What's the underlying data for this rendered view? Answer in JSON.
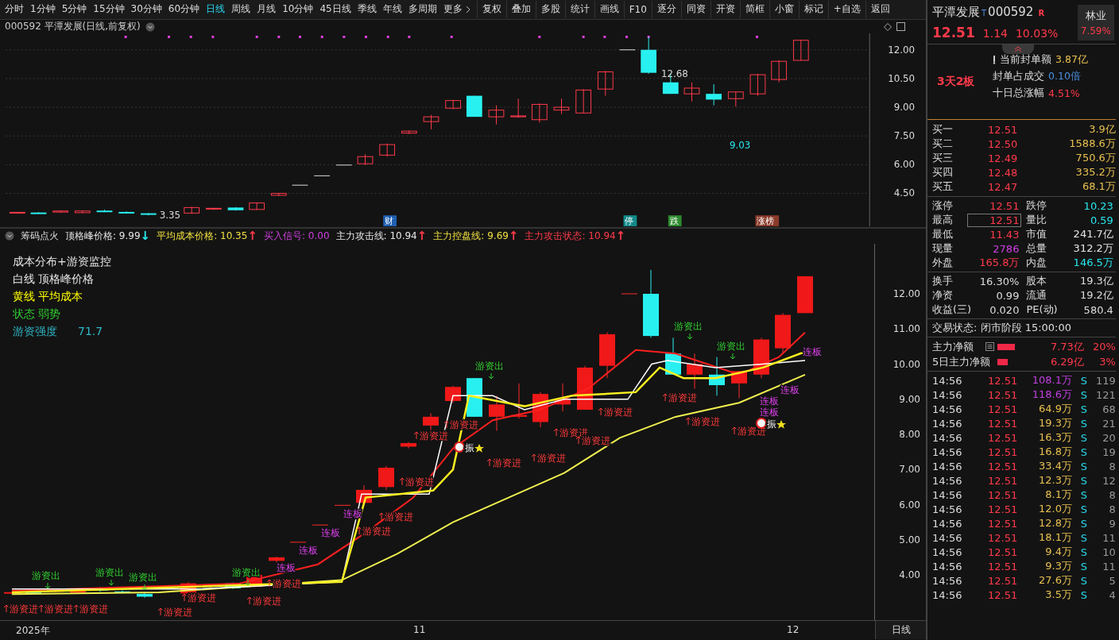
{
  "toolbar": {
    "periods": [
      {
        "label": "分时",
        "selected": false
      },
      {
        "label": "1分钟",
        "selected": false
      },
      {
        "label": "5分钟",
        "selected": false
      },
      {
        "label": "15分钟",
        "selected": false
      },
      {
        "label": "30分钟",
        "selected": false
      },
      {
        "label": "60分钟",
        "selected": false
      },
      {
        "label": "日线",
        "selected": true
      },
      {
        "label": "周线",
        "selected": false
      },
      {
        "label": "月线",
        "selected": false
      },
      {
        "label": "10分钟",
        "selected": false
      },
      {
        "label": "45日线",
        "selected": false
      },
      {
        "label": "季线",
        "selected": false
      },
      {
        "label": "年线",
        "selected": false
      },
      {
        "label": "多周期",
        "selected": false
      }
    ],
    "more": "更多",
    "tools": [
      "复权",
      "叠加",
      "多股",
      "统计",
      "画线",
      "F10",
      "逐分",
      "同资",
      "开资",
      "简框",
      "小窗",
      "标记",
      "+自选",
      "返回"
    ]
  },
  "price_chart": {
    "title": "000592 平潭发展(日线,前复权)",
    "axis": [
      "12.00",
      "10.50",
      "9.00",
      "7.50",
      "6.00",
      "4.50"
    ],
    "price_marks": [
      {
        "text": "12.68",
        "kind": "high"
      },
      {
        "text": "3.35",
        "kind": "low"
      },
      {
        "text": "9.03",
        "kind": "local"
      }
    ],
    "event_tags": [
      {
        "text": "财",
        "color": "#1f5fb0"
      },
      {
        "text": "停",
        "color": "#138a8a"
      },
      {
        "text": "跌",
        "color": "#2e8b2e"
      },
      {
        "text": "涨榜",
        "color": "#8a3a2a"
      }
    ]
  },
  "indicator": {
    "name": "筹码点火",
    "readouts": [
      {
        "label": "顶格峰价格:",
        "value": "9.99",
        "arrow": {
          "text": "↓",
          "color": "#28e8f0"
        },
        "color": "#e6e6e6"
      },
      {
        "label": "平均成本价格:",
        "value": "10.35",
        "arrow": {
          "text": "↑",
          "color": "#ff3a4a"
        },
        "color": "#f0e040"
      },
      {
        "label": "买入信号:",
        "value": "0.00",
        "color": "#d040e0"
      },
      {
        "label": "主力攻击线:",
        "value": "10.94",
        "arrow": {
          "text": "↑",
          "color": "#ff3a4a"
        },
        "color": "#e6e6e6"
      },
      {
        "label": "主力控盘线:",
        "value": "9.69",
        "arrow": {
          "text": "↑",
          "color": "#ff3a4a"
        },
        "color": "#f0e040"
      },
      {
        "label": "主力攻击状态:",
        "value": "10.94",
        "arrow": {
          "text": "↑",
          "color": "#ff3a4a"
        },
        "color": "#ff3a4a"
      }
    ],
    "legend": [
      {
        "text": "成本分布+游资监控",
        "color": "#e6e6e6"
      },
      {
        "text": "白线 顶格峰价格",
        "color": "#e6e6e6"
      },
      {
        "text": "黄线 平均成本",
        "color": "#ffff00"
      },
      {
        "text": "状态 弱势",
        "color": "#30d030"
      },
      {
        "text": "游资强度",
        "value": "71.7",
        "color": "#30b8c8"
      }
    ],
    "axis": [
      "12.00",
      "11.00",
      "10.00",
      "9.00",
      "8.00",
      "7.00",
      "6.00",
      "5.00",
      "4.00"
    ],
    "signals": [
      {
        "kind": "out",
        "text": "游资出"
      },
      {
        "kind": "out",
        "text": "游资出"
      },
      {
        "kind": "out",
        "text": "游资出"
      },
      {
        "kind": "out",
        "text": "游资出"
      },
      {
        "kind": "out",
        "text": "游资出"
      },
      {
        "kind": "out",
        "text": "游资出"
      },
      {
        "kind": "out",
        "text": "游资出"
      },
      {
        "kind": "in",
        "text": "游资进"
      },
      {
        "kind": "in",
        "text": "游资进"
      },
      {
        "kind": "in",
        "text": "游资进"
      },
      {
        "kind": "in",
        "text": "游资进"
      },
      {
        "kind": "in",
        "text": "游资进"
      },
      {
        "kind": "in",
        "text": "游资进"
      },
      {
        "kind": "in",
        "text": "游资进"
      },
      {
        "kind": "in",
        "text": "游资进"
      },
      {
        "kind": "in",
        "text": "游资进"
      },
      {
        "kind": "in",
        "text": "游资进"
      },
      {
        "kind": "in",
        "text": "游资进"
      },
      {
        "kind": "in",
        "text": "游资进"
      },
      {
        "kind": "in",
        "text": "游资进"
      },
      {
        "kind": "in",
        "text": "游资进"
      },
      {
        "kind": "in",
        "text": "游资进"
      },
      {
        "kind": "in",
        "text": "游资进"
      },
      {
        "kind": "in",
        "text": "游资进"
      },
      {
        "kind": "in",
        "text": "游资进"
      },
      {
        "kind": "in",
        "text": "游资进"
      },
      {
        "kind": "in",
        "text": "游资进"
      },
      {
        "kind": "board",
        "text": "连板"
      },
      {
        "kind": "board",
        "text": "连板"
      },
      {
        "kind": "board",
        "text": "连板"
      },
      {
        "kind": "board",
        "text": "连板"
      },
      {
        "kind": "board",
        "text": "连板"
      },
      {
        "kind": "board",
        "text": "连板"
      },
      {
        "kind": "board",
        "text": "连板"
      },
      {
        "kind": "board",
        "text": "连板"
      },
      {
        "kind": "start",
        "text": "振"
      },
      {
        "kind": "start",
        "text": "振"
      }
    ]
  },
  "time_axis": {
    "labels": [
      "2025年",
      "11",
      "12"
    ],
    "period_button": "日线"
  },
  "quote": {
    "name": "平潭发展",
    "t_mark": "T",
    "code": "000592",
    "r_mark": "R",
    "industry": "林业",
    "industry_change": "7.59%",
    "price": "12.51",
    "change": "1.14",
    "change_pct": "10.03%",
    "streak": "3天2板",
    "seal": [
      {
        "label": "当前封单额",
        "value": "3.87亿",
        "color": "#e8c050"
      },
      {
        "label": "封单占成交",
        "value": "0.10倍",
        "color": "#4a90e0"
      },
      {
        "label": "十日总涨幅",
        "value": "4.51%",
        "color": "#ff3a4a"
      }
    ],
    "book": [
      {
        "label": "买一",
        "price": "12.51",
        "volume": "3.9亿"
      },
      {
        "label": "买二",
        "price": "12.50",
        "volume": "1588.6万"
      },
      {
        "label": "买三",
        "price": "12.49",
        "volume": "750.6万"
      },
      {
        "label": "买四",
        "price": "12.48",
        "volume": "335.2万"
      },
      {
        "label": "买五",
        "price": "12.47",
        "volume": "68.1万"
      }
    ],
    "stats": [
      {
        "label": "涨停",
        "value": "12.51",
        "color": "#ff3a4a",
        "boxed": false
      },
      {
        "label": "跌停",
        "value": "10.23",
        "color": "#28e8f0",
        "boxed": false
      },
      {
        "label": "最高",
        "value": "12.51",
        "color": "#ff3a4a",
        "boxed": true
      },
      {
        "label": "量比",
        "value": "0.59",
        "color": "#28e8f0",
        "boxed": false
      },
      {
        "label": "最低",
        "value": "11.43",
        "color": "#ff3a4a",
        "boxed": false
      },
      {
        "label": "市值",
        "value": "241.7亿",
        "color": "#e6e6e6",
        "boxed": false
      },
      {
        "label": "现量",
        "value": "2786",
        "color": "#d040e0",
        "boxed": false
      },
      {
        "label": "总量",
        "value": "312.2万",
        "color": "#e6e6e6",
        "boxed": false
      },
      {
        "label": "外盘",
        "value": "165.8万",
        "color": "#ff3a4a",
        "boxed": false
      },
      {
        "label": "内盘",
        "value": "146.5万",
        "color": "#28e8f0",
        "boxed": false
      }
    ],
    "stats2": [
      {
        "label": "换手",
        "value": "16.30%"
      },
      {
        "label": "股本",
        "value": "19.3亿"
      },
      {
        "label": "净资",
        "value": "0.99"
      },
      {
        "label": "流通",
        "value": "19.2亿"
      },
      {
        "label": "收益(三)",
        "value": "0.020"
      },
      {
        "label": "PE(动)",
        "value": "580.4"
      }
    ],
    "status": "交易状态: 闭市阶段 15:00:00",
    "flows": [
      {
        "label": "主力净额",
        "value": "7.73亿",
        "pct": "20%"
      },
      {
        "label": "5日主力净额",
        "value": "6.29亿",
        "pct": "3%"
      }
    ],
    "trades": [
      {
        "time": "14:56",
        "price": "12.51",
        "volume": "108.1万",
        "kind": "big",
        "side": "S",
        "count": "119"
      },
      {
        "time": "14:56",
        "price": "12.51",
        "volume": "118.6万",
        "kind": "big",
        "side": "S",
        "count": "121"
      },
      {
        "time": "14:56",
        "price": "12.51",
        "volume": "64.9万",
        "kind": "normal",
        "side": "S",
        "count": "68"
      },
      {
        "time": "14:56",
        "price": "12.51",
        "volume": "19.3万",
        "kind": "normal",
        "side": "S",
        "count": "21"
      },
      {
        "time": "14:56",
        "price": "12.51",
        "volume": "16.3万",
        "kind": "normal",
        "side": "S",
        "count": "20"
      },
      {
        "time": "14:56",
        "price": "12.51",
        "volume": "16.8万",
        "kind": "normal",
        "side": "S",
        "count": "19"
      },
      {
        "time": "14:56",
        "price": "12.51",
        "volume": "33.4万",
        "kind": "normal",
        "side": "S",
        "count": "8"
      },
      {
        "time": "14:56",
        "price": "12.51",
        "volume": "12.3万",
        "kind": "normal",
        "side": "S",
        "count": "12"
      },
      {
        "time": "14:56",
        "price": "12.51",
        "volume": "8.1万",
        "kind": "normal",
        "side": "S",
        "count": "8"
      },
      {
        "time": "14:56",
        "price": "12.51",
        "volume": "12.0万",
        "kind": "normal",
        "side": "S",
        "count": "8"
      },
      {
        "time": "14:56",
        "price": "12.51",
        "volume": "12.8万",
        "kind": "normal",
        "side": "S",
        "count": "9"
      },
      {
        "time": "14:56",
        "price": "12.51",
        "volume": "18.1万",
        "kind": "normal",
        "side": "S",
        "count": "11"
      },
      {
        "time": "14:56",
        "price": "12.51",
        "volume": "9.4万",
        "kind": "normal",
        "side": "S",
        "count": "10"
      },
      {
        "time": "14:56",
        "price": "12.51",
        "volume": "9.3万",
        "kind": "normal",
        "side": "S",
        "count": "11"
      },
      {
        "time": "14:56",
        "price": "12.51",
        "volume": "27.6万",
        "kind": "normal",
        "side": "S",
        "count": "5"
      },
      {
        "time": "14:56",
        "price": "12.51",
        "volume": "3.5万",
        "kind": "normal",
        "side": "S",
        "count": "4"
      }
    ]
  }
}
